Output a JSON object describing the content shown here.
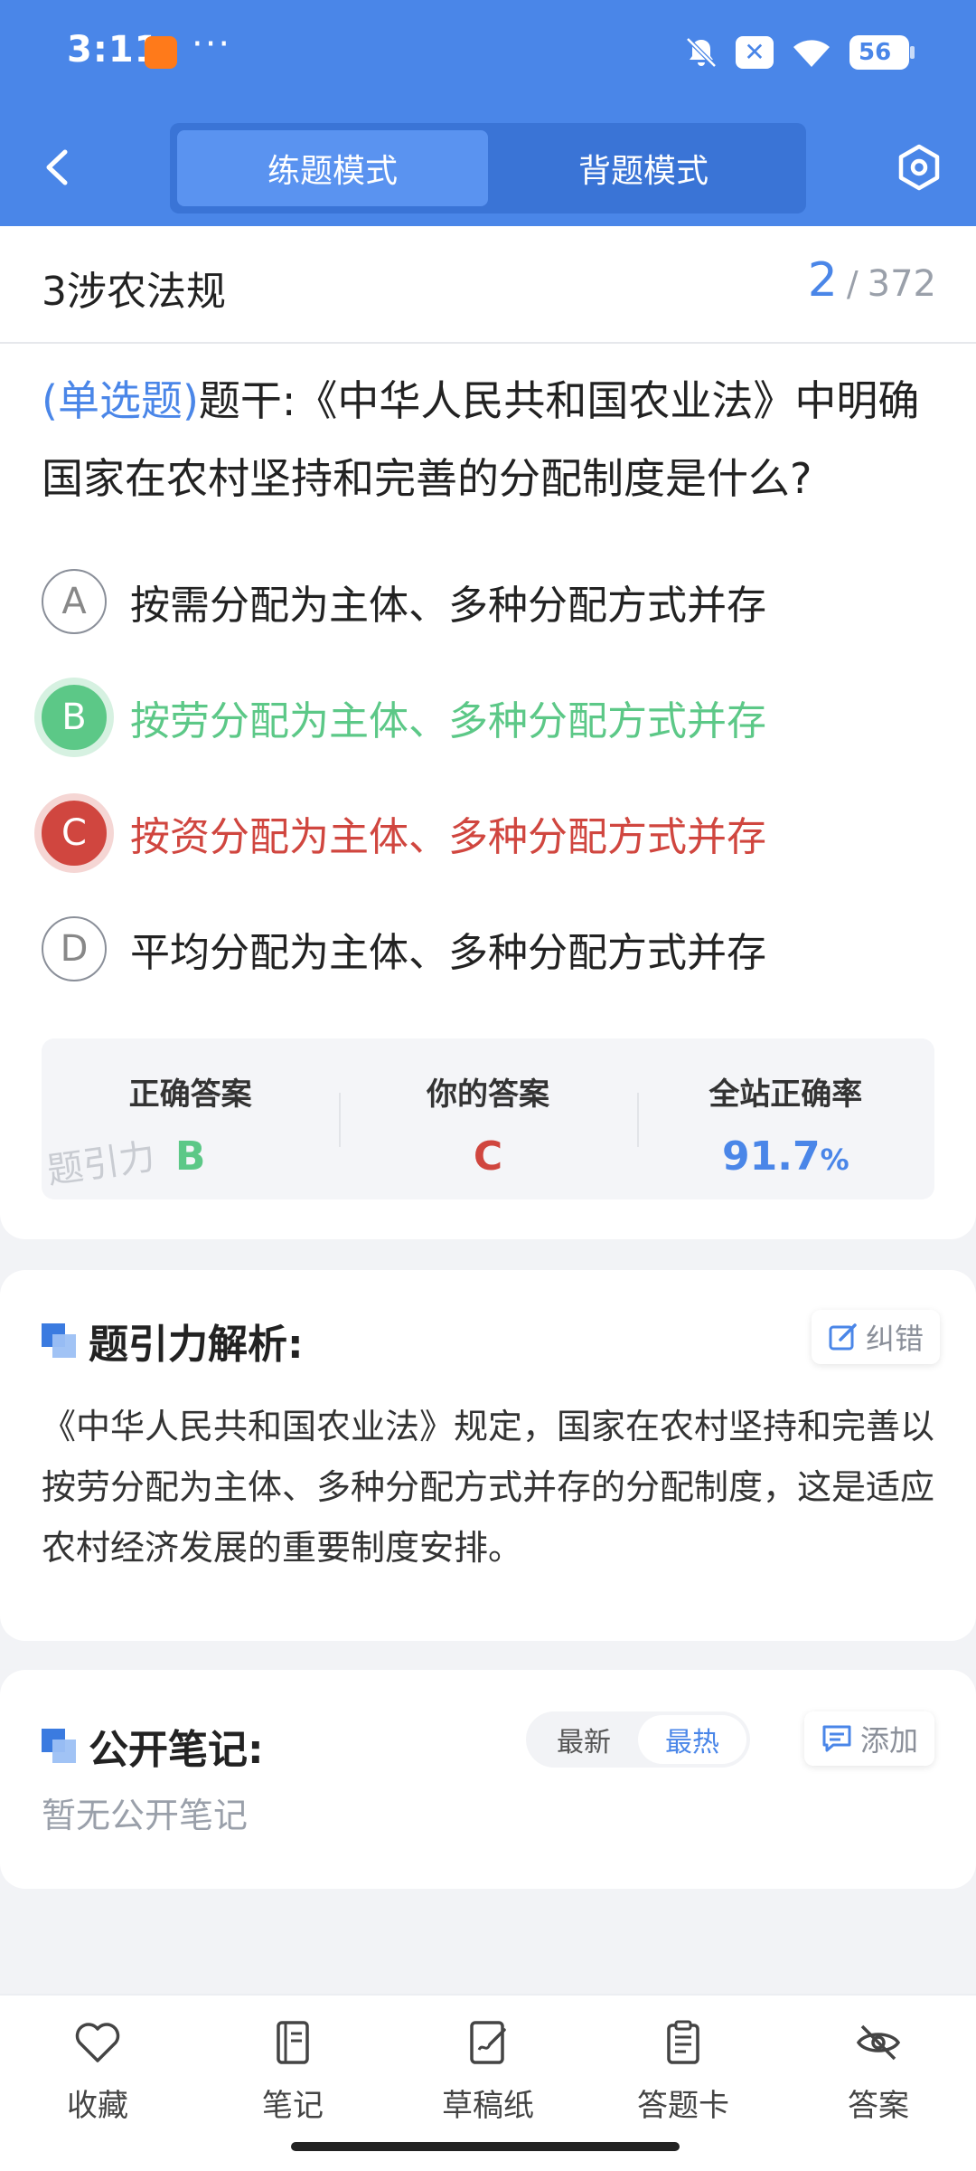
{
  "status_bar": {
    "time": "3:11",
    "dots": "···",
    "battery": "56",
    "icons": [
      "orange-app-notification-icon",
      "bell-off-icon",
      "close-badge-icon",
      "wifi-icon",
      "battery-icon"
    ]
  },
  "header": {
    "back_icon": "chevron-left-icon",
    "tabs": [
      {
        "label": "练题模式",
        "active": true
      },
      {
        "label": "背题模式",
        "active": false
      }
    ],
    "settings_icon": "hexagon-settings-icon",
    "color": "#4a86e8"
  },
  "section": {
    "title": "3涉农法规",
    "current": "2",
    "separator": "/",
    "total": "372"
  },
  "question": {
    "type": "(单选题)",
    "stem": "题干:《中华人民共和国农业法》中明确国家在农村坚持和完善的分配制度是什么?"
  },
  "options": [
    {
      "letter": "A",
      "text": "按需分配为主体、多种分配方式并存",
      "state": "normal"
    },
    {
      "letter": "B",
      "text": "按劳分配为主体、多种分配方式并存",
      "state": "correct"
    },
    {
      "letter": "C",
      "text": "按资分配为主体、多种分配方式并存",
      "state": "wrong"
    },
    {
      "letter": "D",
      "text": "平均分配为主体、多种分配方式并存",
      "state": "normal"
    }
  ],
  "answer_summary": {
    "correct_label": "正确答案",
    "correct_value": "B",
    "yours_label": "你的答案",
    "yours_value": "C",
    "rate_label": "全站正确率",
    "rate_value": "91.7",
    "rate_unit": "%",
    "watermark": "题引力"
  },
  "analysis": {
    "title": "题引力解析:",
    "report_label": "纠错",
    "text": "《中华人民共和国农业法》规定，国家在农村坚持和完善以按劳分配为主体、多种分配方式并存的分配制度，这是适应农村经济发展的重要制度安排。"
  },
  "notes": {
    "title": "公开笔记:",
    "sort_options": [
      "最新",
      "最热"
    ],
    "sort_active": "最热",
    "add_label": "添加",
    "empty_text": "暂无公开笔记"
  },
  "bottom_nav": [
    {
      "label": "收藏",
      "icon": "heart-icon"
    },
    {
      "label": "笔记",
      "icon": "notebook-icon"
    },
    {
      "label": "草稿纸",
      "icon": "draft-paper-icon"
    },
    {
      "label": "答题卡",
      "icon": "answer-sheet-icon"
    },
    {
      "label": "答案",
      "icon": "eye-off-icon"
    }
  ],
  "colors": {
    "accent": "#4a86e8",
    "correct": "#5cc887",
    "wrong": "#d0463f"
  }
}
